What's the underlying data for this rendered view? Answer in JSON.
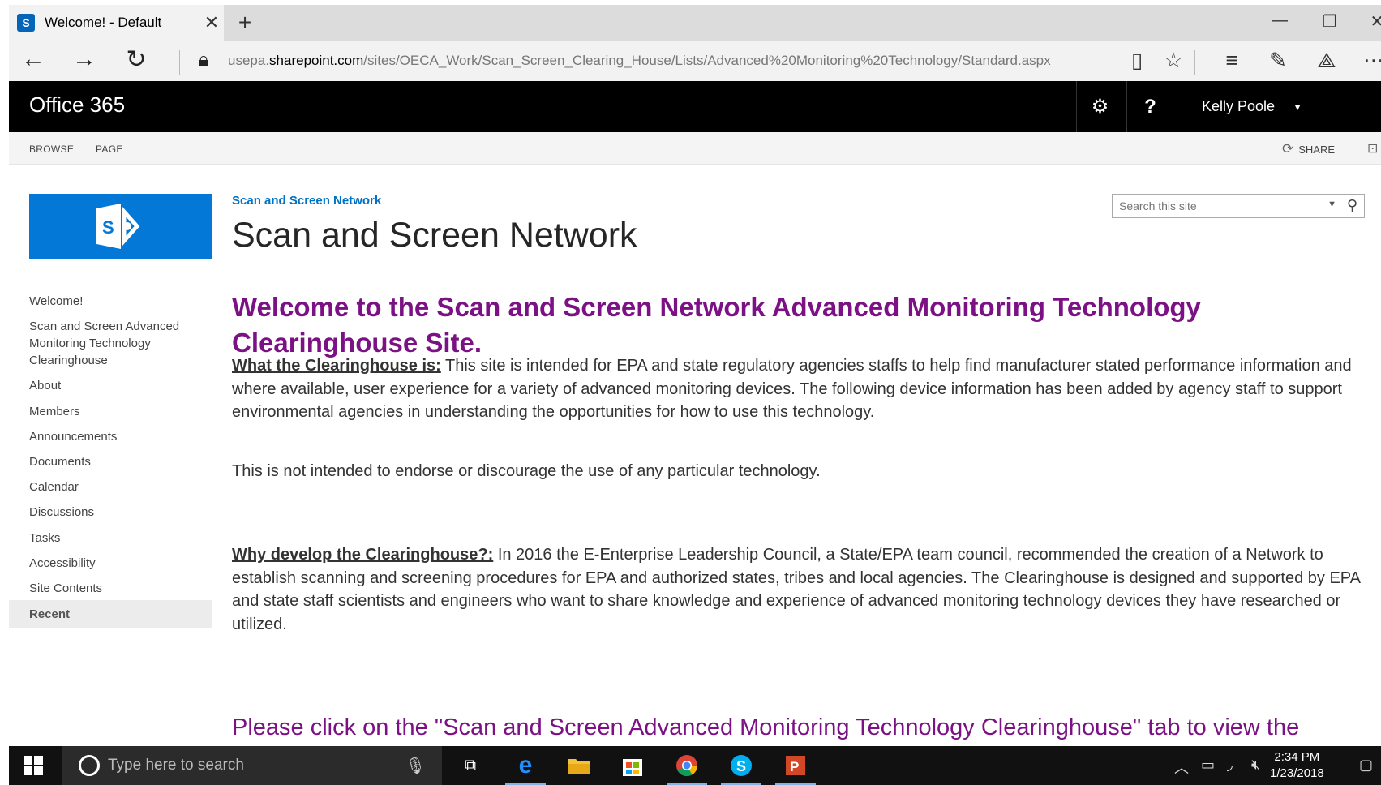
{
  "browser": {
    "tab_title": "Welcome! - Default",
    "url_prefix": "usepa.",
    "url_host": "sharepoint.com",
    "url_path": "/sites/OECA_Work/Scan_Screen_Clearing_House/Lists/Advanced%20Monitoring%20Technology/Standard.aspx"
  },
  "suitebar": {
    "brand": "Office 365",
    "help": "?",
    "user_name": "Kelly Poole"
  },
  "ribbon": {
    "tabs": [
      "BROWSE",
      "PAGE"
    ],
    "share_label": "SHARE"
  },
  "quicklaunch": {
    "items": [
      "Welcome!",
      "Scan and Screen Advanced Monitoring Technology Clearinghouse",
      "About",
      "Members",
      "Announcements",
      "Documents",
      "Calendar",
      "Discussions",
      "Tasks",
      "Accessibility",
      "Site Contents",
      "Recent"
    ]
  },
  "header": {
    "breadcrumb": "Scan and Screen Network",
    "page_title": "Scan and Screen Network",
    "search_placeholder": "Search this site"
  },
  "content": {
    "welcome_heading": "Welcome to the Scan and Screen Network Advanced Monitoring Technology Clearinghouse Site.",
    "what_lead": "What the Clearinghouse is:",
    "what_text": " This site is intended for EPA and state regulatory agencies staffs to help find manufacturer stated performance information and where available, user experience for a variety of advanced monitoring devices. The following device information has been added by agency staff to support environmental agencies in understanding the opportunities for how to use this technology.",
    "disclaimer": "This is not intended to endorse or discourage the use of any particular technology.",
    "why_lead": "Why develop the Clearinghouse?:",
    "why_text": "  In 2016 the E-Enterprise Leadership Council, a State/EPA team council, recommended the creation of a Network to establish scanning and screening procedures for EPA and authorized states, tribes and local agencies.  The Clearinghouse is designed and supported by EPA and state staff scientists and engineers who want to share knowledge and experience of advanced monitoring technology devices they have researched or utilized.",
    "please_text": "Please click on the \"Scan and Screen Advanced Monitoring Technology Clearinghouse\" tab to view the"
  },
  "taskbar": {
    "search_placeholder": "Type here to search",
    "time": "2:34 PM",
    "date": "1/23/2018",
    "apps": [
      "task-view",
      "edge",
      "file-explorer",
      "store",
      "chrome",
      "skype",
      "powerpoint"
    ]
  }
}
